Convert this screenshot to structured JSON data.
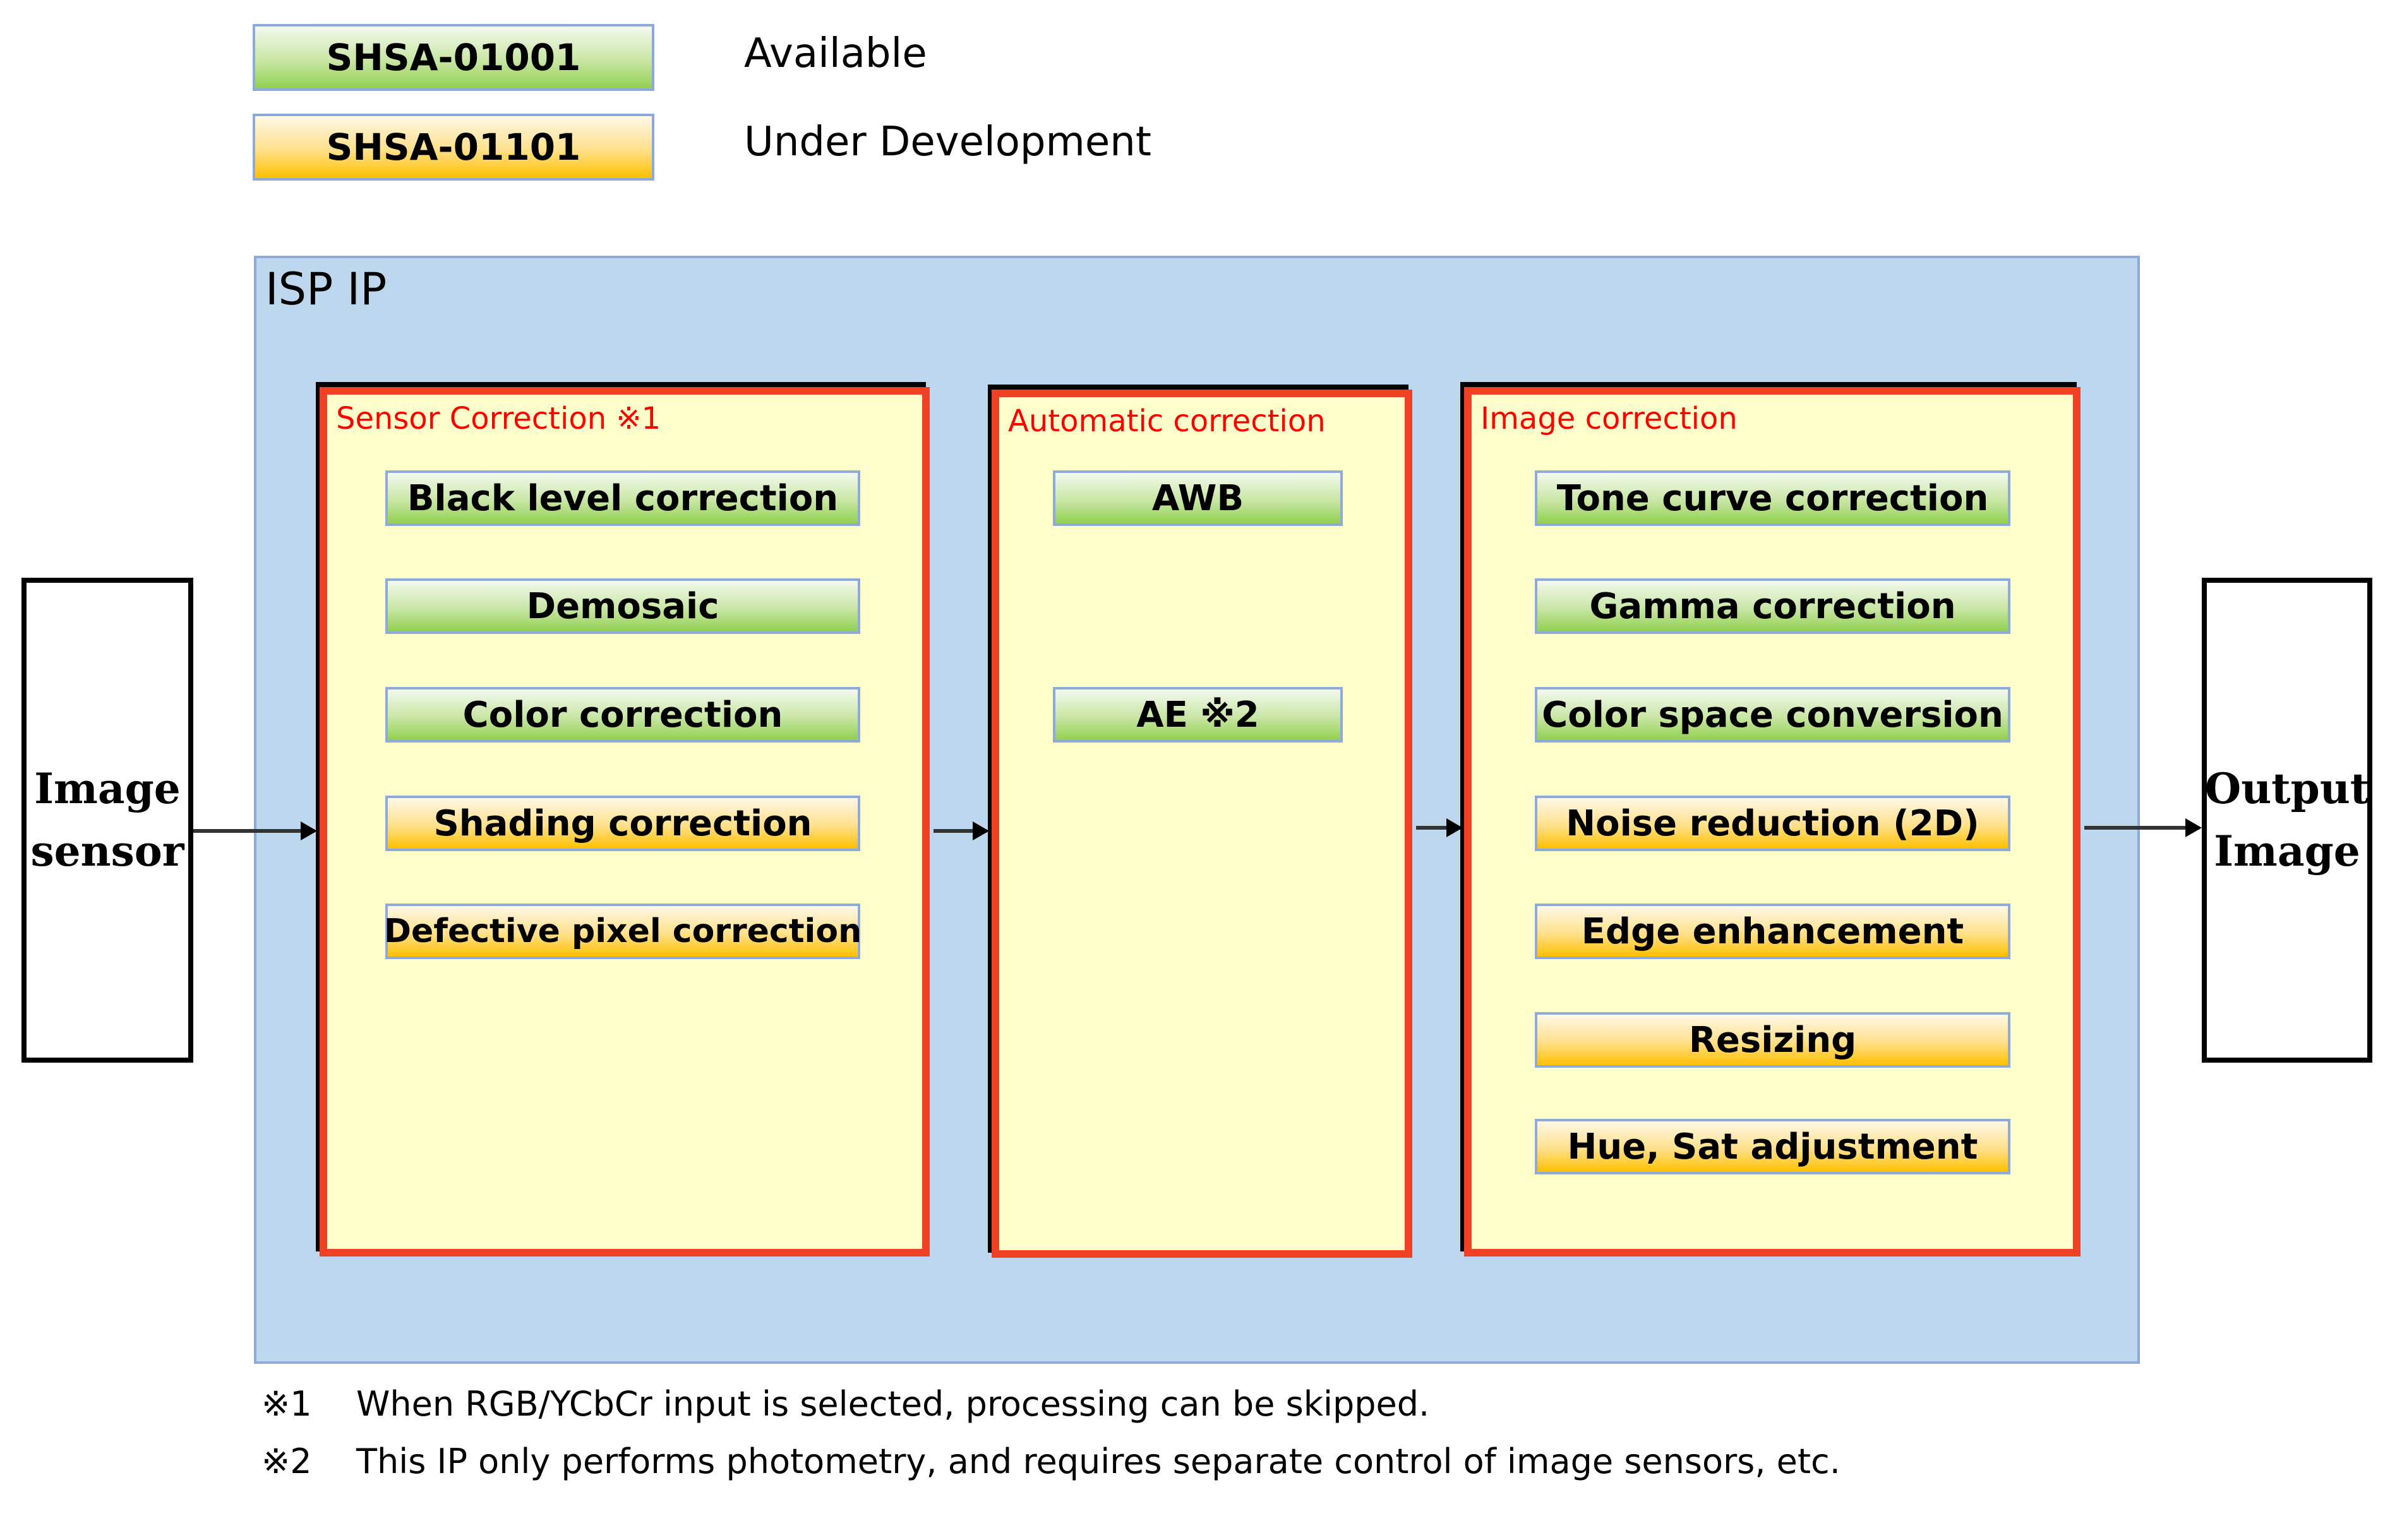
{
  "legend": [
    {
      "code": "SHSA-01001",
      "status": "Available",
      "color": "green"
    },
    {
      "code": "SHSA-01101",
      "status": "Under Development",
      "color": "orange"
    }
  ],
  "isp": {
    "title": "ISP IP",
    "stages": [
      {
        "title": "Sensor Correction ※1",
        "items": [
          {
            "label": "Black level correction",
            "status": "Available"
          },
          {
            "label": "Demosaic",
            "status": "Available"
          },
          {
            "label": "Color correction",
            "status": "Available"
          },
          {
            "label": "Shading correction",
            "status": "Under Development"
          },
          {
            "label": "Defective pixel correction",
            "status": "Under Development"
          }
        ]
      },
      {
        "title": "Automatic correction",
        "items": [
          {
            "label": "AWB",
            "status": "Available"
          },
          {
            "label": "AE ※2",
            "status": "Available"
          }
        ]
      },
      {
        "title": "Image correction",
        "items": [
          {
            "label": "Tone curve correction",
            "status": "Available"
          },
          {
            "label": "Gamma correction",
            "status": "Available"
          },
          {
            "label": "Color space conversion",
            "status": "Available"
          },
          {
            "label": "Noise reduction (2D)",
            "status": "Under Development"
          },
          {
            "label": "Edge enhancement",
            "status": "Under Development"
          },
          {
            "label": "Resizing",
            "status": "Under Development"
          },
          {
            "label": "Hue, Sat adjustment",
            "status": "Under Development"
          }
        ]
      }
    ]
  },
  "input": {
    "line1": "Image",
    "line2": "sensor"
  },
  "output": {
    "line1": "Output",
    "line2": "Image"
  },
  "notes": [
    {
      "mark": "※1",
      "text": "When RGB/YCbCr input is selected, processing can be skipped."
    },
    {
      "mark": "※2",
      "text": "This IP only performs photometry, and requires separate control of image sensors, etc."
    }
  ],
  "colors": {
    "available": "#92d050",
    "under_development": "#ffc000",
    "container": "#bdd7ee",
    "stage_fill": "#ffffcc",
    "stage_border": "#f04124",
    "stage_title": "#ff0000"
  }
}
